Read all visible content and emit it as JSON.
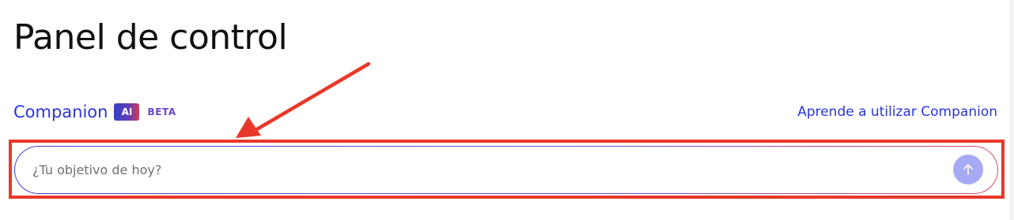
{
  "page": {
    "title": "Panel de control"
  },
  "companion": {
    "title": "Companion",
    "ai_badge": "AI",
    "beta_label": "BETA",
    "learn_link": "Aprende a utilizar Companion",
    "input_placeholder": "¿Tu objetivo de hoy?",
    "send_icon": "arrow-up-icon"
  },
  "annotation": {
    "color": "#e8382a"
  },
  "colors": {
    "accent": "#2b35d9",
    "send_button": "#a6aaf4"
  }
}
